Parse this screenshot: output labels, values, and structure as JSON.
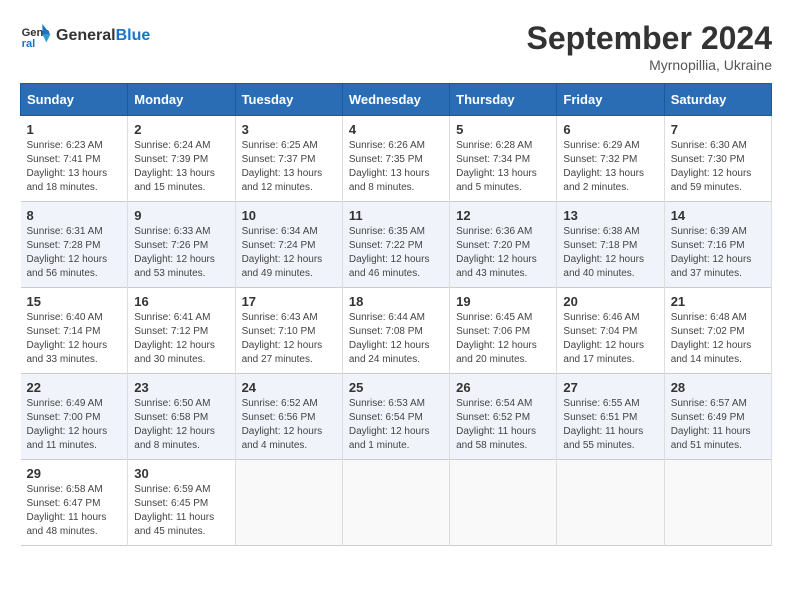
{
  "header": {
    "logo_line1": "General",
    "logo_line2": "Blue",
    "month": "September 2024",
    "location": "Myrnopillia, Ukraine"
  },
  "weekdays": [
    "Sunday",
    "Monday",
    "Tuesday",
    "Wednesday",
    "Thursday",
    "Friday",
    "Saturday"
  ],
  "weeks": [
    [
      {
        "day": "1",
        "sunrise": "6:23 AM",
        "sunset": "7:41 PM",
        "daylight": "13 hours and 18 minutes."
      },
      {
        "day": "2",
        "sunrise": "6:24 AM",
        "sunset": "7:39 PM",
        "daylight": "13 hours and 15 minutes."
      },
      {
        "day": "3",
        "sunrise": "6:25 AM",
        "sunset": "7:37 PM",
        "daylight": "13 hours and 12 minutes."
      },
      {
        "day": "4",
        "sunrise": "6:26 AM",
        "sunset": "7:35 PM",
        "daylight": "13 hours and 8 minutes."
      },
      {
        "day": "5",
        "sunrise": "6:28 AM",
        "sunset": "7:34 PM",
        "daylight": "13 hours and 5 minutes."
      },
      {
        "day": "6",
        "sunrise": "6:29 AM",
        "sunset": "7:32 PM",
        "daylight": "13 hours and 2 minutes."
      },
      {
        "day": "7",
        "sunrise": "6:30 AM",
        "sunset": "7:30 PM",
        "daylight": "12 hours and 59 minutes."
      }
    ],
    [
      {
        "day": "8",
        "sunrise": "6:31 AM",
        "sunset": "7:28 PM",
        "daylight": "12 hours and 56 minutes."
      },
      {
        "day": "9",
        "sunrise": "6:33 AM",
        "sunset": "7:26 PM",
        "daylight": "12 hours and 53 minutes."
      },
      {
        "day": "10",
        "sunrise": "6:34 AM",
        "sunset": "7:24 PM",
        "daylight": "12 hours and 49 minutes."
      },
      {
        "day": "11",
        "sunrise": "6:35 AM",
        "sunset": "7:22 PM",
        "daylight": "12 hours and 46 minutes."
      },
      {
        "day": "12",
        "sunrise": "6:36 AM",
        "sunset": "7:20 PM",
        "daylight": "12 hours and 43 minutes."
      },
      {
        "day": "13",
        "sunrise": "6:38 AM",
        "sunset": "7:18 PM",
        "daylight": "12 hours and 40 minutes."
      },
      {
        "day": "14",
        "sunrise": "6:39 AM",
        "sunset": "7:16 PM",
        "daylight": "12 hours and 37 minutes."
      }
    ],
    [
      {
        "day": "15",
        "sunrise": "6:40 AM",
        "sunset": "7:14 PM",
        "daylight": "12 hours and 33 minutes."
      },
      {
        "day": "16",
        "sunrise": "6:41 AM",
        "sunset": "7:12 PM",
        "daylight": "12 hours and 30 minutes."
      },
      {
        "day": "17",
        "sunrise": "6:43 AM",
        "sunset": "7:10 PM",
        "daylight": "12 hours and 27 minutes."
      },
      {
        "day": "18",
        "sunrise": "6:44 AM",
        "sunset": "7:08 PM",
        "daylight": "12 hours and 24 minutes."
      },
      {
        "day": "19",
        "sunrise": "6:45 AM",
        "sunset": "7:06 PM",
        "daylight": "12 hours and 20 minutes."
      },
      {
        "day": "20",
        "sunrise": "6:46 AM",
        "sunset": "7:04 PM",
        "daylight": "12 hours and 17 minutes."
      },
      {
        "day": "21",
        "sunrise": "6:48 AM",
        "sunset": "7:02 PM",
        "daylight": "12 hours and 14 minutes."
      }
    ],
    [
      {
        "day": "22",
        "sunrise": "6:49 AM",
        "sunset": "7:00 PM",
        "daylight": "12 hours and 11 minutes."
      },
      {
        "day": "23",
        "sunrise": "6:50 AM",
        "sunset": "6:58 PM",
        "daylight": "12 hours and 8 minutes."
      },
      {
        "day": "24",
        "sunrise": "6:52 AM",
        "sunset": "6:56 PM",
        "daylight": "12 hours and 4 minutes."
      },
      {
        "day": "25",
        "sunrise": "6:53 AM",
        "sunset": "6:54 PM",
        "daylight": "12 hours and 1 minute."
      },
      {
        "day": "26",
        "sunrise": "6:54 AM",
        "sunset": "6:52 PM",
        "daylight": "11 hours and 58 minutes."
      },
      {
        "day": "27",
        "sunrise": "6:55 AM",
        "sunset": "6:51 PM",
        "daylight": "11 hours and 55 minutes."
      },
      {
        "day": "28",
        "sunrise": "6:57 AM",
        "sunset": "6:49 PM",
        "daylight": "11 hours and 51 minutes."
      }
    ],
    [
      {
        "day": "29",
        "sunrise": "6:58 AM",
        "sunset": "6:47 PM",
        "daylight": "11 hours and 48 minutes."
      },
      {
        "day": "30",
        "sunrise": "6:59 AM",
        "sunset": "6:45 PM",
        "daylight": "11 hours and 45 minutes."
      },
      null,
      null,
      null,
      null,
      null
    ]
  ]
}
